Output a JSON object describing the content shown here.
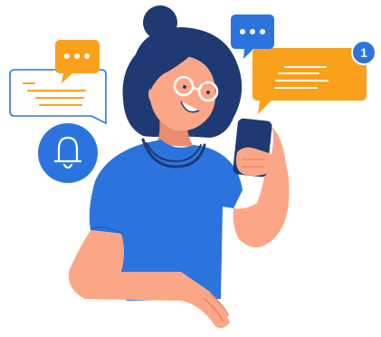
{
  "notification": {
    "badge_count": "1"
  },
  "colors": {
    "orange": "#FBA01B",
    "blue": "#2C74DD",
    "navy": "#1F3A72",
    "skin": "#FBA787",
    "skin_shadow": "#E88E6E",
    "white": "#FFFFFF"
  },
  "icons": [
    "chat-bubble-icon",
    "bell-icon",
    "ellipsis-icon",
    "smartphone-icon"
  ]
}
